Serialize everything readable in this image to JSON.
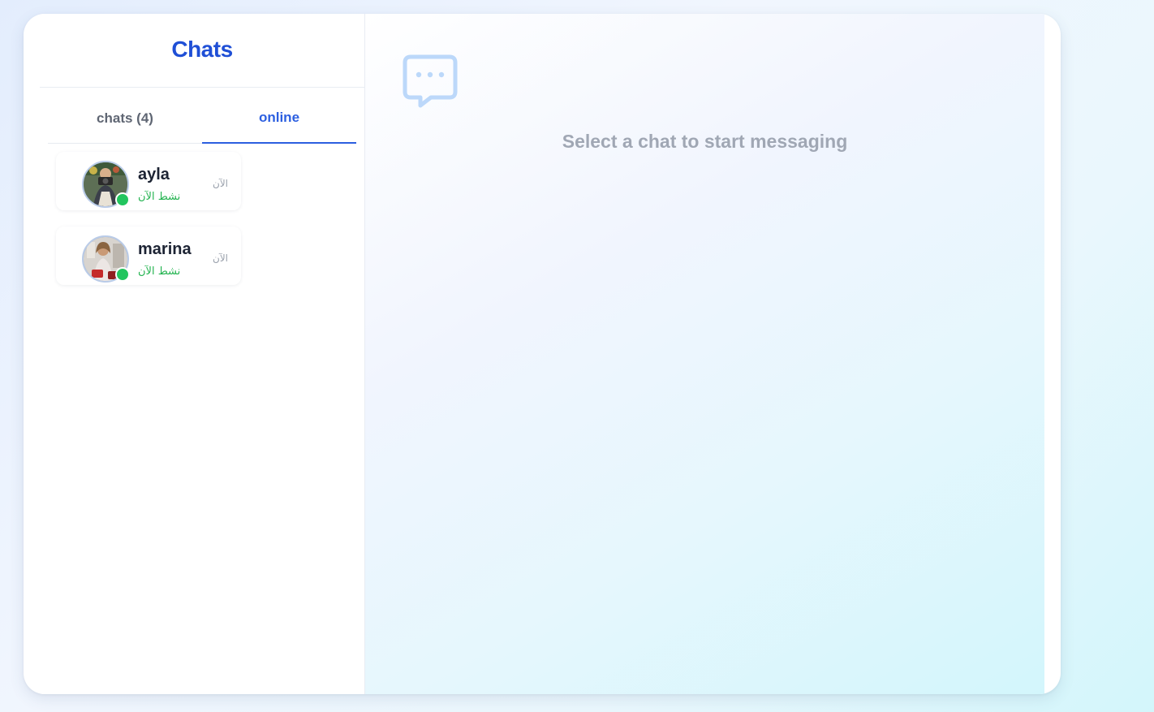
{
  "sidebar": {
    "title": "Chats",
    "tabs": [
      {
        "label": "chats (4)",
        "active": false
      },
      {
        "label": "online",
        "active": true
      }
    ],
    "chats": [
      {
        "name": "ayla",
        "status": "نشط الآن",
        "time": "الآن",
        "online": true
      },
      {
        "name": "marina",
        "status": "نشط الآن",
        "time": "الآن",
        "online": true
      }
    ]
  },
  "main": {
    "empty_icon": "chat-bubble-icon",
    "empty_message": "Select a chat to start messaging"
  },
  "colors": {
    "brand": "#1f4fd6",
    "tab_active": "#2c5fe0",
    "online": "#22c55e",
    "muted_text": "#a0a7b4"
  }
}
